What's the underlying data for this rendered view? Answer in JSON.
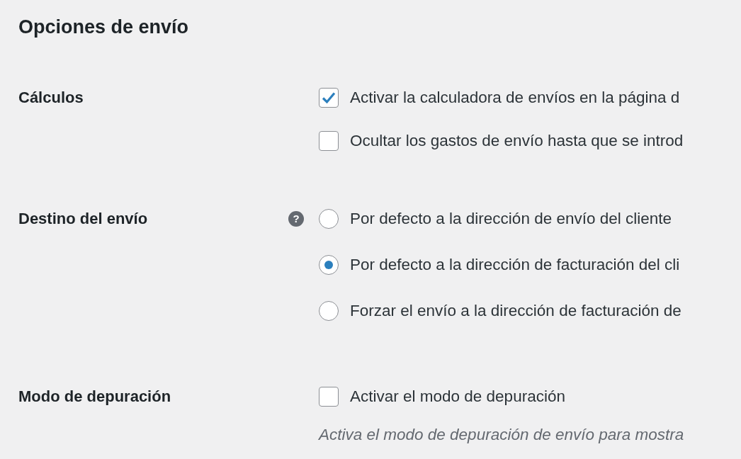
{
  "title": "Opciones de envío",
  "sections": [
    {
      "label": "Cálculos",
      "options": [
        {
          "kind": "checkbox",
          "text": "Activar la calculadora de envíos en la página d",
          "checked": true
        },
        {
          "kind": "checkbox",
          "text": "Ocultar los gastos de envío hasta que se introd",
          "checked": false
        }
      ]
    },
    {
      "label": "Destino del envío",
      "help_icon": "?",
      "options": [
        {
          "kind": "radio",
          "text": "Por defecto a la dirección de envío del cliente",
          "selected": false
        },
        {
          "kind": "radio",
          "text": "Por defecto a la dirección de facturación del cli",
          "selected": true
        },
        {
          "kind": "radio",
          "text": "Forzar el envío a la dirección de facturación de",
          "selected": false
        }
      ]
    },
    {
      "label": "Modo de depuración",
      "options": [
        {
          "kind": "checkbox",
          "text": "Activar el modo de depuración",
          "checked": false
        }
      ],
      "description": "Activa el modo de depuración de envío para mostra"
    }
  ]
}
